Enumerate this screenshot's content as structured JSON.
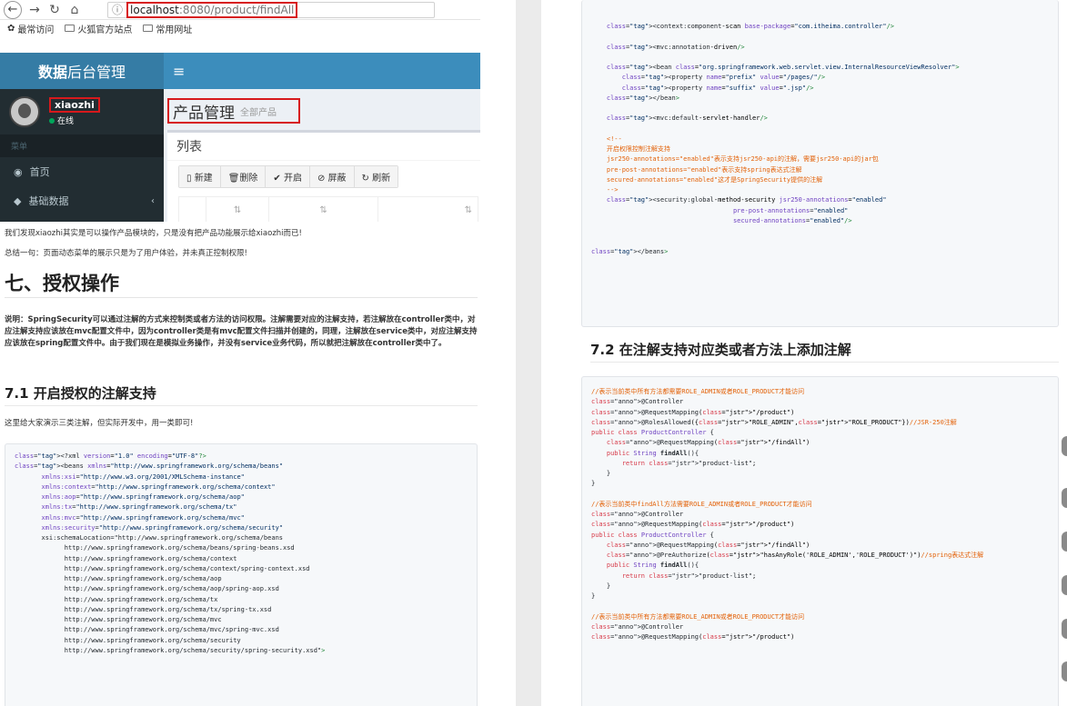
{
  "browser": {
    "nav": {
      "back_icon": "arrow-left",
      "forward_icon": "arrow-right",
      "reload_icon": "reload",
      "home_icon": "home"
    },
    "info_icon": "ⓘ",
    "url_host": "localhost",
    "url_path": ":8080/product/findAll",
    "bookmarks": [
      "最常访问",
      "火狐官方站点",
      "常用网址"
    ]
  },
  "admin": {
    "logo_bold": "数据",
    "logo_rest": "后台管理",
    "toggle": "≡",
    "user_name": "xiaozhi",
    "user_status": "在线",
    "menu_header": "菜单",
    "menu_items": [
      "首页",
      "基础数据"
    ],
    "page_title": "产品管理",
    "page_subtitle": "全部产品",
    "box_title": "列表",
    "toolbar": [
      "新建",
      "删除",
      "开启",
      "屏蔽",
      "刷新"
    ]
  },
  "article": {
    "p1": "我们发现xiaozhi其实是可以操作产品模块的，只是没有把产品功能展示给xiaozhi而已!",
    "p2": "总结一句：页面动态菜单的展示只是为了用户体验，并未真正控制权限!",
    "h2": "七、授权操作",
    "note": "说明：SpringSecurity可以通过注解的方式来控制类或者方法的访问权限。注解需要对应的注解支持，若注解放在controller类中，对应注解支持应该放在mvc配置文件中，因为controller类是有mvc配置文件扫描并创建的，同理，注解放在service类中，对应注解支持应该放在spring配置文件中。由于我们现在是模拟业务操作，并没有service业务代码，所以就把注解放在controller类中了。",
    "h3_1": "7.1 开启授权的注解支持",
    "p3": "这里给大家演示三类注解，但实际开发中，用一类即可!",
    "h3_2": "7.2 在注解支持对应类或者方法上添加注解"
  },
  "code_xml_left": [
    "<?xml version=\"1.0\" encoding=\"UTF-8\"?>",
    "<beans xmlns=\"http://www.springframework.org/schema/beans\"",
    "       xmlns:xsi=\"http://www.w3.org/2001/XMLSchema-instance\"",
    "       xmlns:context=\"http://www.springframework.org/schema/context\"",
    "       xmlns:aop=\"http://www.springframework.org/schema/aop\"",
    "       xmlns:tx=\"http://www.springframework.org/schema/tx\"",
    "       xmlns:mvc=\"http://www.springframework.org/schema/mvc\"",
    "       xmlns:security=\"http://www.springframework.org/schema/security\"",
    "       xsi:schemaLocation=\"http://www.springframework.org/schema/beans",
    "             http://www.springframework.org/schema/beans/spring-beans.xsd",
    "             http://www.springframework.org/schema/context",
    "             http://www.springframework.org/schema/context/spring-context.xsd",
    "             http://www.springframework.org/schema/aop",
    "             http://www.springframework.org/schema/aop/spring-aop.xsd",
    "             http://www.springframework.org/schema/tx",
    "             http://www.springframework.org/schema/tx/spring-tx.xsd",
    "             http://www.springframework.org/schema/mvc",
    "             http://www.springframework.org/schema/mvc/spring-mvc.xsd",
    "             http://www.springframework.org/schema/security",
    "             http://www.springframework.org/schema/security/spring-security.xsd\">"
  ],
  "code_xml_right": [
    "    <context:component-scan base-package=\"com.itheima.controller\"/>",
    "",
    "    <mvc:annotation-driven/>",
    "",
    "    <bean class=\"org.springframework.web.servlet.view.InternalResourceViewResolver\">",
    "        <property name=\"prefix\" value=\"/pages/\"/>",
    "        <property name=\"suffix\" value=\".jsp\"/>",
    "    </bean>",
    "",
    "    <mvc:default-servlet-handler/>",
    "",
    "    <!--",
    "    开启权限控制注解支持",
    "    jsr250-annotations=\"enabled\"表示支持jsr250-api的注解，需要jsr250-api的jar包",
    "    pre-post-annotations=\"enabled\"表示支持spring表达式注解",
    "    secured-annotations=\"enabled\"这才是SpringSecurity提供的注解",
    "    -->",
    "    <security:global-method-security jsr250-annotations=\"enabled\"",
    "                                     pre-post-annotations=\"enabled\"",
    "                                     secured-annotations=\"enabled\"/>",
    "",
    "",
    "</beans>"
  ],
  "code_java": [
    "//表示当前类中所有方法都需要ROLE_ADMIN或者ROLE_PRODUCT才能访问",
    "@Controller",
    "@RequestMapping(\"/product\")",
    "@RolesAllowed({\"ROLE_ADMIN\",\"ROLE_PRODUCT\"})//JSR-250注解",
    "public class ProductController {",
    "    @RequestMapping(\"/findAll\")",
    "    public String findAll(){",
    "        return \"product-list\";",
    "    }",
    "}",
    "",
    "//表示当前类中findAll方法需要ROLE_ADMIN或者ROLE_PRODUCT才能访问",
    "@Controller",
    "@RequestMapping(\"/product\")",
    "public class ProductController {",
    "    @RequestMapping(\"/findAll\")",
    "    @PreAuthorize(\"hasAnyRole('ROLE_ADMIN','ROLE_PRODUCT')\")//spring表达式注解",
    "    public String findAll(){",
    "        return \"product-list\";",
    "    }",
    "}",
    "",
    "//表示当前类中所有方法都需要ROLE_ADMIN或者ROLE_PRODUCT才能访问",
    "@Controller",
    "@RequestMapping(\"/product\")"
  ]
}
